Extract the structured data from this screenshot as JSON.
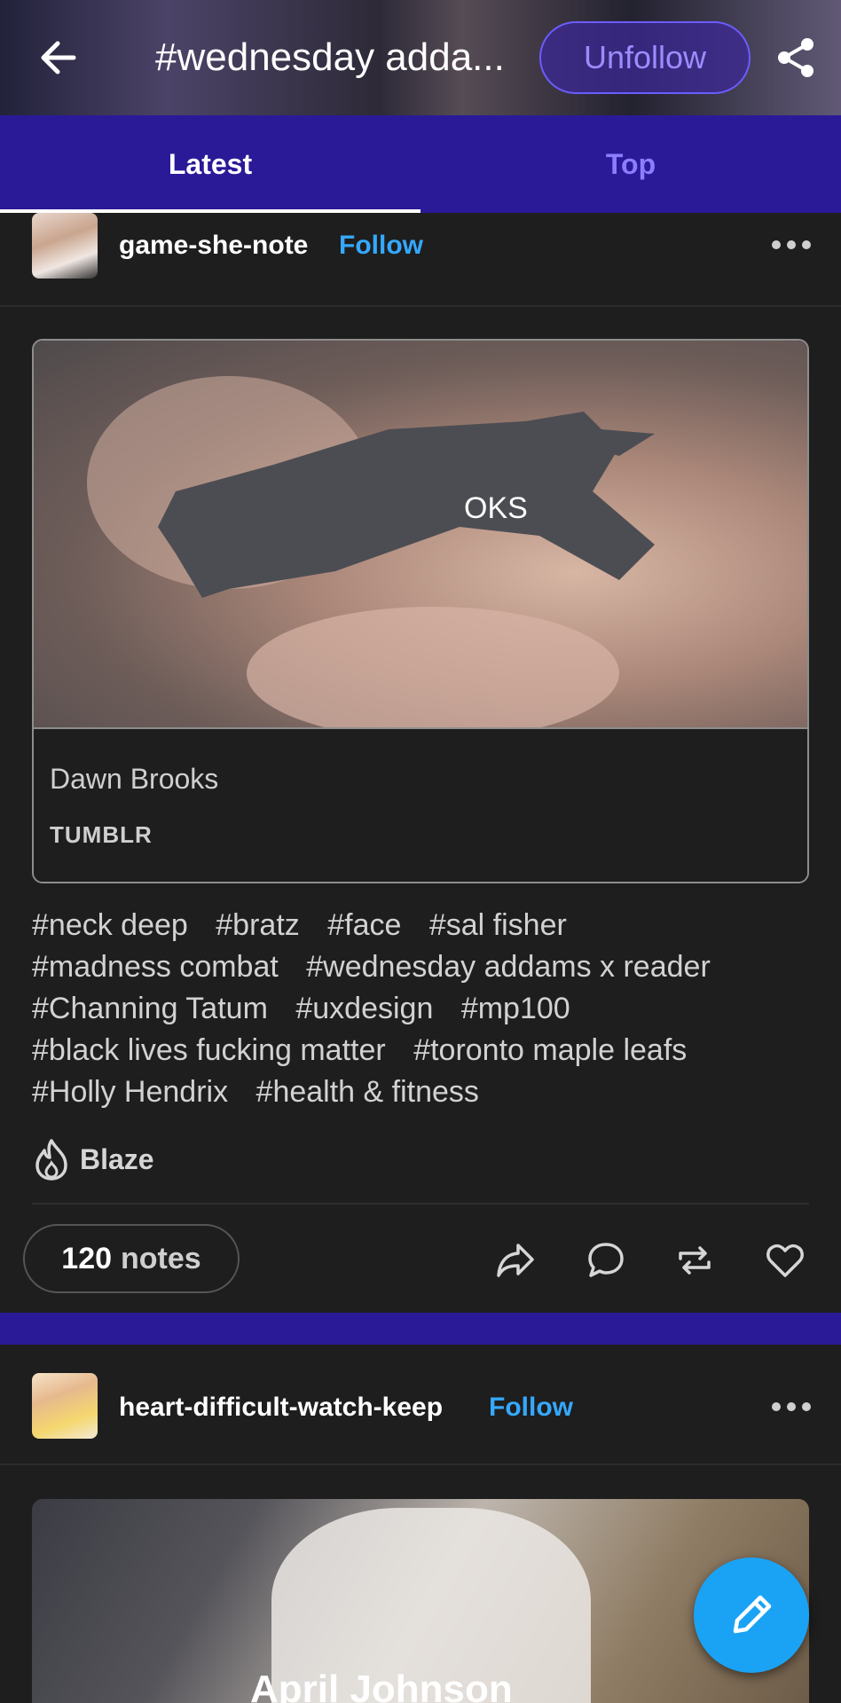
{
  "header": {
    "title": "#wednesday adda...",
    "unfollow_label": "Unfollow"
  },
  "tabs": [
    {
      "label": "Latest",
      "active": true
    },
    {
      "label": "Top",
      "active": false
    }
  ],
  "posts": [
    {
      "username": "game-she-note",
      "follow_label": "Follow",
      "card": {
        "title": "Dawn Brooks",
        "source": "TUMBLR"
      },
      "tags": [
        "#neck deep",
        "#bratz",
        "#face",
        "#sal fisher",
        "#madness combat",
        "#wednesday addams x reader",
        "#Channing Tatum",
        "#uxdesign",
        "#mp100",
        "#black lives fucking matter",
        "#toronto maple leafs",
        "#Holly Hendrix",
        "#health & fitness"
      ],
      "blaze_label": "Blaze",
      "notes_count": "120",
      "notes_label": "notes"
    },
    {
      "username": "heart-difficult-watch-keep",
      "follow_label": "Follow",
      "card": {
        "title": "April Johnson"
      }
    }
  ],
  "colors": {
    "accent": "#2a1a98",
    "follow_link": "#35a8ff",
    "fab": "#1aa3f5"
  },
  "icons": [
    "back-arrow-icon",
    "share-icon",
    "more-icon",
    "fire-icon",
    "share-arrow-icon",
    "comment-icon",
    "reblog-icon",
    "heart-icon",
    "pencil-icon"
  ]
}
